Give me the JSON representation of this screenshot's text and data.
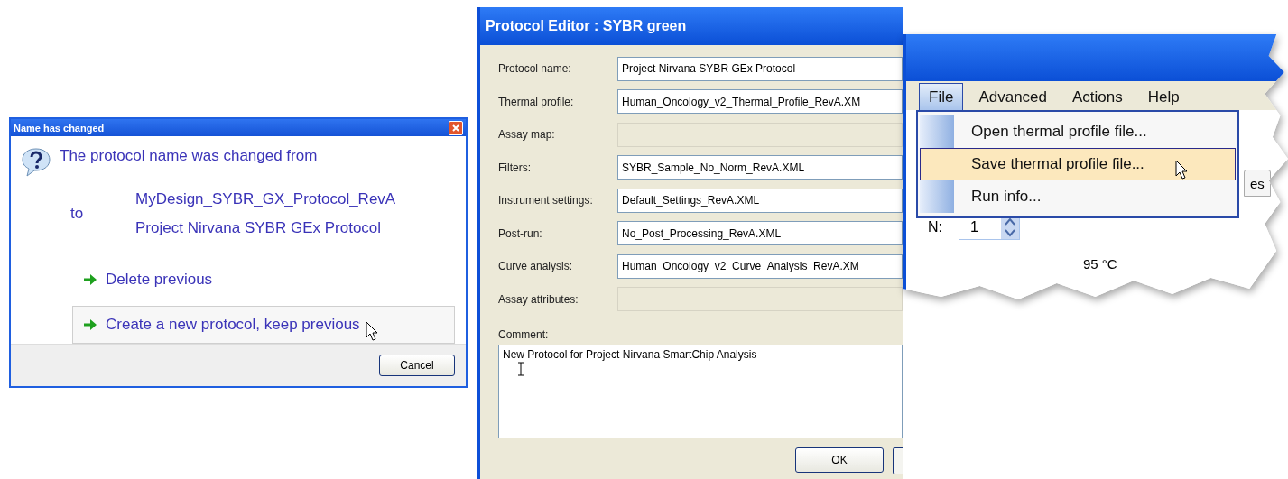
{
  "name_changed_dialog": {
    "title": "Name has changed",
    "message": "The protocol name was changed from",
    "old_name": "MyDesign_SYBR_GX_Protocol_RevA",
    "connector": "to",
    "new_name": "Project Nirvana SYBR GEx Protocol",
    "options": [
      {
        "label": "Delete previous",
        "selected": false
      },
      {
        "label": "Create a new protocol, keep previous",
        "selected": true
      }
    ],
    "cancel_button": "Cancel"
  },
  "protocol_editor": {
    "title": "Protocol Editor : SYBR green",
    "fields": [
      {
        "label": "Protocol name:",
        "value": "Project Nirvana SYBR GEx Protocol",
        "disabled": false
      },
      {
        "label": "Thermal profile:",
        "value": "Human_Oncology_v2_Thermal_Profile_RevA.XM",
        "disabled": false
      },
      {
        "label": "Assay map:",
        "disabled": true
      },
      {
        "label": "Filters:",
        "value": "SYBR_Sample_No_Norm_RevA.XML",
        "disabled": false
      },
      {
        "label": "Instrument settings:",
        "value": "Default_Settings_RevA.XML",
        "disabled": false
      },
      {
        "label": "Post-run:",
        "value": "No_Post_Processing_RevA.XML",
        "disabled": false
      },
      {
        "label": "Curve analysis:",
        "value": "Human_Oncology_v2_Curve_Analysis_RevA.XM",
        "disabled": false
      },
      {
        "label": "Assay attributes:",
        "disabled": true
      }
    ],
    "comment_label": "Comment:",
    "comment": "New Protocol for Project Nirvana SmartChip Analysis",
    "ok_button": "OK"
  },
  "thermal_window": {
    "menu": [
      {
        "label": "File",
        "selected": true
      },
      {
        "label": "Advanced",
        "selected": false
      },
      {
        "label": "Actions",
        "selected": false
      },
      {
        "label": "Help",
        "selected": false
      }
    ],
    "file_menu": [
      {
        "label": "Open thermal profile file...",
        "selected": false
      },
      {
        "label": "Save thermal profile file...",
        "selected": true
      },
      {
        "label": "Run info...",
        "selected": false
      }
    ],
    "tabs": [
      "es"
    ],
    "n_label": "N:",
    "n_value": "1",
    "temperature": "95 °C"
  }
}
